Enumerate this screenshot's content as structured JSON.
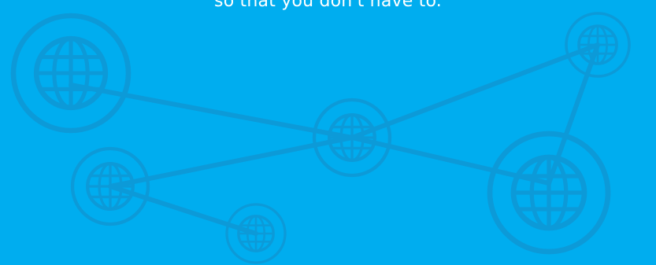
{
  "hero": {
    "tagline": "so that you don't have to."
  },
  "colors": {
    "background": "#00adef",
    "network": "#0c9ad8",
    "text": "#ffffff"
  },
  "icons": {
    "node": "globe-icon"
  }
}
